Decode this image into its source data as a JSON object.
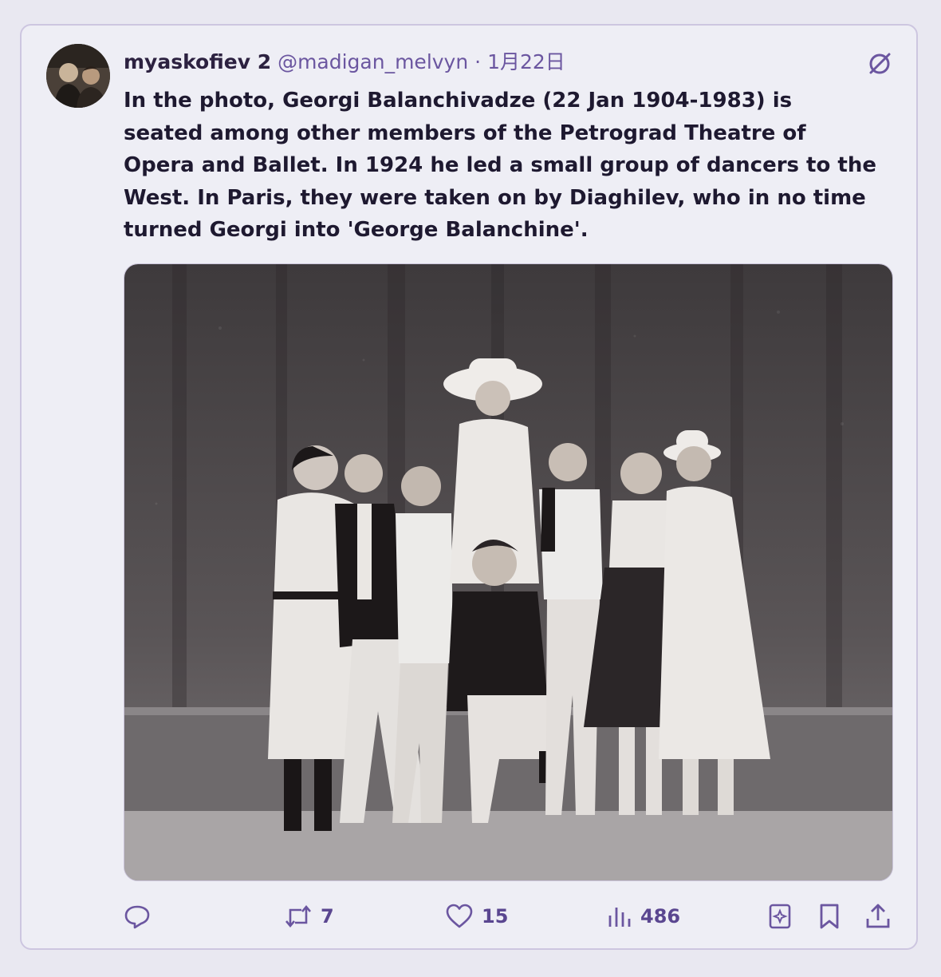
{
  "post": {
    "author_name": "myaskofiev 2",
    "handle": "@madigan_melvyn",
    "separator": "·",
    "date": "1月22日",
    "text": "In the photo, Georgi Balanchivadze (22 Jan 1904-1983) is seated among other members of the Petrograd Theatre of Opera and Ballet. In 1924 he led a small group of dancers to the West. In Paris, they were taken on by Diaghilev, who in no time turned Georgi into 'George Balanchine'.",
    "menu_icon": "slashed-circle-icon",
    "photo": "black-and-white group photo of dancers"
  },
  "actions": {
    "reply": {
      "icon": "reply-icon",
      "count": ""
    },
    "repost": {
      "icon": "repost-icon",
      "count": "7"
    },
    "like": {
      "icon": "heart-icon",
      "count": "15"
    },
    "views": {
      "icon": "bar-chart-icon",
      "count": "486"
    },
    "grok": {
      "icon": "sparkle-bookmark-icon"
    },
    "bookmark": {
      "icon": "bookmark-icon"
    },
    "share": {
      "icon": "share-icon"
    }
  },
  "colors": {
    "accent": "#6b56a0",
    "text": "#1e1930",
    "card_bg": "#eeeef5",
    "border": "#cdc6e0"
  }
}
